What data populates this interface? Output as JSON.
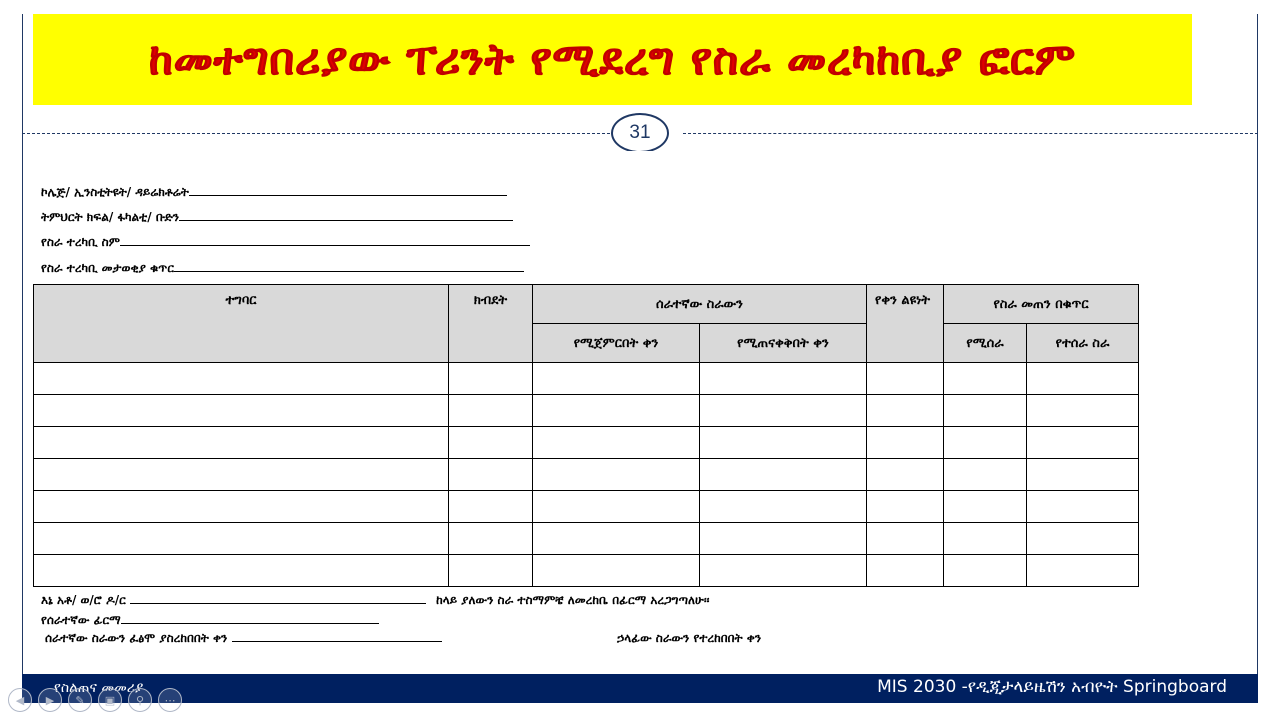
{
  "title": "ከመተግበሪያው ፐሪንት የሚደረግ የስራ መረካከቢያ ፎርም",
  "page_number": "31",
  "fields": [
    {
      "label": "ኮሌጅ/ ኢንስቲትዩት/ ዳይሬክቶሬት"
    },
    {
      "label": "ትምህርት ክፍል/ ፋካልቲ/ ቡድን"
    },
    {
      "label": "የስራ ተረካቢ ስም"
    },
    {
      "label": "የስራ ተረካቢ መታወቂያ ቁጥር"
    }
  ],
  "table": {
    "headers": {
      "activity": "ተግባር",
      "weight": "ክብደት",
      "worker_work": "ሰራተኛው ስራውን",
      "start_date": "የሚጀምርበት ቀን",
      "end_date": "የሚጠናቀቅበት ቀን",
      "day_diff": "የቀን ልዩነት",
      "quantity": "የስራ መጠን በቁጥር",
      "to_do": "የሚሰራ",
      "done": "የተሰራ ስራ"
    },
    "empty_rows": 7
  },
  "signature": {
    "name_prefix": "እኔ አቶ/ ወ/ሮ ዶ/ር",
    "statement": "ከላይ ያለውን ስራ ተስማምቼ ለመረከቤ በፊርማ አረጋግጣለሁ፡፡",
    "worker_signature": "የሰራተኛው ፊርማ",
    "completion_date": "ሰራተኛው ስራውን ፈፅሞ ያስረከበበት ቀን",
    "head_received_date": "ኃላፊው ስራውን የተረከበበት ቀን"
  },
  "footer": {
    "left": "የስልጠና መመሪያ",
    "right": "MIS 2030 -የዲጂታላይዜሽን አብዮት Springboard"
  },
  "colors": {
    "title_bg": "#ffff00",
    "title_text": "#e00000",
    "footer_bg": "#002060",
    "header_bg": "#d9d9d9"
  },
  "controls": [
    "prev-icon",
    "play-icon",
    "pen-icon",
    "slides-icon",
    "zoom-icon",
    "more-icon"
  ]
}
